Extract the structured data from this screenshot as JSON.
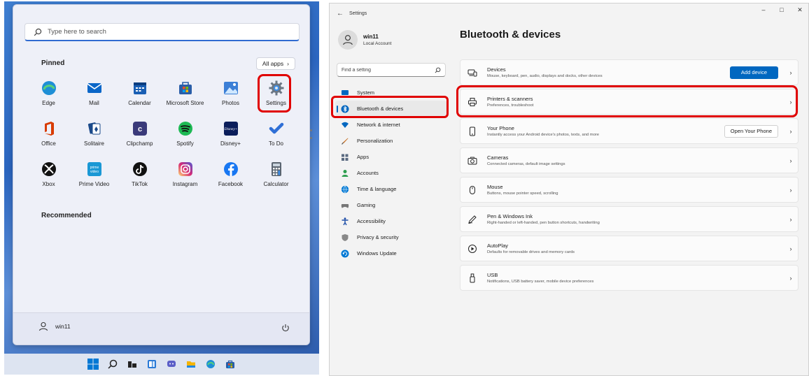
{
  "start_menu": {
    "search_placeholder": "Type here to search",
    "pinned_label": "Pinned",
    "all_apps_label": "All apps",
    "recommended_label": "Recommended",
    "user_name": "win11",
    "pinned_apps": [
      {
        "label": "Edge",
        "icon": "edge-icon",
        "color": "#1e8fd6"
      },
      {
        "label": "Mail",
        "icon": "mail-icon",
        "color": "#0a66c8"
      },
      {
        "label": "Calendar",
        "icon": "calendar-icon",
        "color": "#1a5fb4"
      },
      {
        "label": "Microsoft Store",
        "icon": "store-icon",
        "color": "#2a5ea8"
      },
      {
        "label": "Photos",
        "icon": "photos-icon",
        "color": "#3c7fd6"
      },
      {
        "label": "Settings",
        "icon": "settings-gear-icon",
        "color": "#6b7785"
      },
      {
        "label": "Office",
        "icon": "office-icon",
        "color": "#d83b01"
      },
      {
        "label": "Solitaire",
        "icon": "solitaire-icon",
        "color": "#1b4a8a"
      },
      {
        "label": "Clipchamp",
        "icon": "clipchamp-icon",
        "color": "#3a3a7a"
      },
      {
        "label": "Spotify",
        "icon": "spotify-icon",
        "color": "#1db954"
      },
      {
        "label": "Disney+",
        "icon": "disney-icon",
        "color": "#0b1e5b"
      },
      {
        "label": "To Do",
        "icon": "todo-check-icon",
        "color": "#2f6fd6"
      },
      {
        "label": "Xbox",
        "icon": "xbox-icon",
        "color": "#111111"
      },
      {
        "label": "Prime Video",
        "icon": "prime-video-icon",
        "color": "#1a98d5"
      },
      {
        "label": "TikTok",
        "icon": "tiktok-icon",
        "color": "#111111"
      },
      {
        "label": "Instagram",
        "icon": "instagram-icon",
        "color": "#d62976"
      },
      {
        "label": "Facebook",
        "icon": "facebook-icon",
        "color": "#1877f2"
      },
      {
        "label": "Calculator",
        "icon": "calculator-icon",
        "color": "#5a6470"
      }
    ]
  },
  "settings": {
    "window_title": "Settings",
    "account_name": "win11",
    "account_type": "Local Account",
    "find_placeholder": "Find a setting",
    "page_title": "Bluetooth & devices",
    "nav_items": [
      {
        "label": "System",
        "icon": "system-icon",
        "color": "#0067c0"
      },
      {
        "label": "Bluetooth & devices",
        "icon": "bluetooth-icon",
        "color": "#0067c0"
      },
      {
        "label": "Network & internet",
        "icon": "network-icon",
        "color": "#0067c0"
      },
      {
        "label": "Personalization",
        "icon": "personalization-brush-icon",
        "color": "#c46a1b"
      },
      {
        "label": "Apps",
        "icon": "apps-icon",
        "color": "#5a6a80"
      },
      {
        "label": "Accounts",
        "icon": "accounts-icon",
        "color": "#2e9e4f"
      },
      {
        "label": "Time & language",
        "icon": "time-language-icon",
        "color": "#0078d4"
      },
      {
        "label": "Gaming",
        "icon": "gaming-icon",
        "color": "#777777"
      },
      {
        "label": "Accessibility",
        "icon": "accessibility-icon",
        "color": "#1f4fa8"
      },
      {
        "label": "Privacy & security",
        "icon": "privacy-shield-icon",
        "color": "#888888"
      },
      {
        "label": "Windows Update",
        "icon": "windows-update-icon",
        "color": "#0078d4"
      }
    ],
    "rows": [
      {
        "title": "Devices",
        "subtitle": "Mouse, keyboard, pen, audio, displays and docks, other devices",
        "icon": "devices-icon",
        "button": "Add device",
        "button_type": "primary"
      },
      {
        "title": "Printers & scanners",
        "subtitle": "Preferences, troubleshoot",
        "icon": "printer-icon",
        "button": "",
        "button_type": ""
      },
      {
        "title": "Your Phone",
        "subtitle": "Instantly access your Android device's photos, texts, and more",
        "icon": "phone-icon",
        "button": "Open Your Phone",
        "button_type": "secondary"
      },
      {
        "title": "Cameras",
        "subtitle": "Connected cameras, default image settings",
        "icon": "camera-icon",
        "button": "",
        "button_type": ""
      },
      {
        "title": "Mouse",
        "subtitle": "Buttons, mouse pointer speed, scrolling",
        "icon": "mouse-icon",
        "button": "",
        "button_type": ""
      },
      {
        "title": "Pen & Windows Ink",
        "subtitle": "Right-handed or left-handed, pen button shortcuts, handwriting",
        "icon": "pen-icon",
        "button": "",
        "button_type": ""
      },
      {
        "title": "AutoPlay",
        "subtitle": "Defaults for removable drives and memory cards",
        "icon": "autoplay-icon",
        "button": "",
        "button_type": ""
      },
      {
        "title": "USB",
        "subtitle": "Notifications, USB battery saver, mobile device preferences",
        "icon": "usb-icon",
        "button": "",
        "button_type": ""
      }
    ]
  }
}
